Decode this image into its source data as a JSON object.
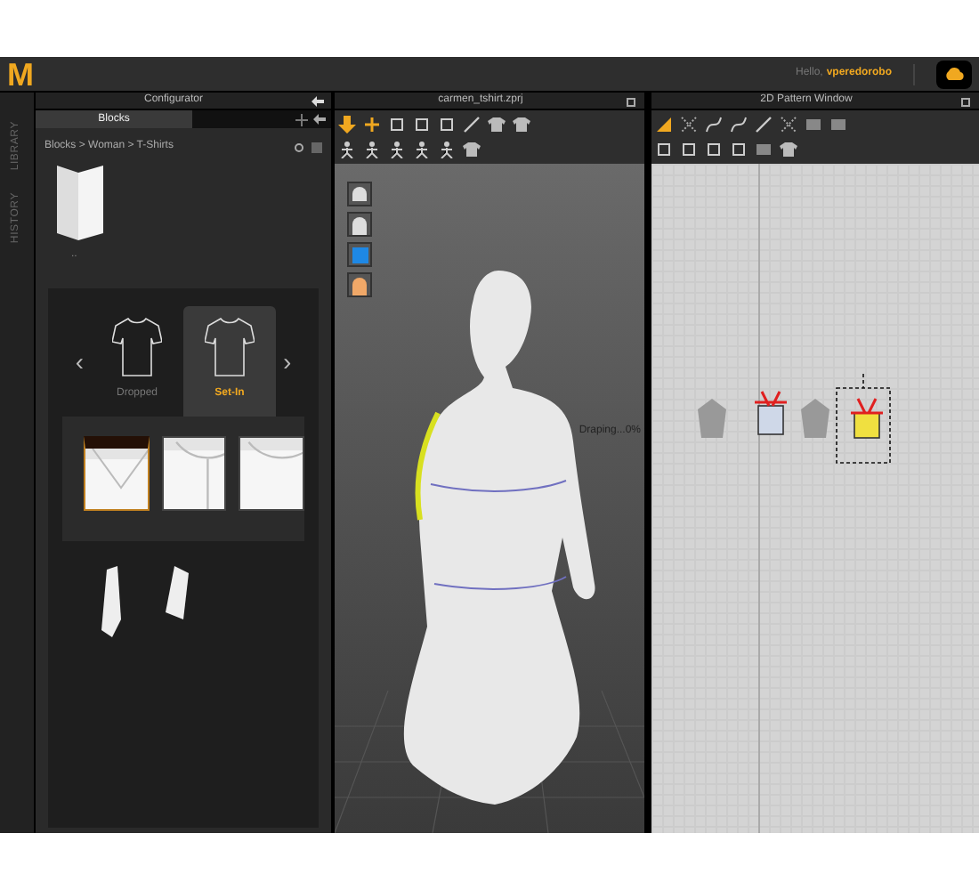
{
  "top_bar": {
    "logo": "M",
    "greeting": "Hello,",
    "user": "vperedorobo"
  },
  "side_tabs": [
    {
      "label": "LIBRARY"
    },
    {
      "label": "HISTORY"
    }
  ],
  "configurator": {
    "title": "Configurator",
    "tabs": [
      {
        "label": "Blocks",
        "selected": true
      }
    ],
    "breadcrumb": "Blocks > Woman > T-Shirts",
    "folder_label": "..",
    "carousel": {
      "previous": "‹",
      "next": "›"
    },
    "styles": [
      {
        "label": "Dropped",
        "selected": false
      },
      {
        "label": "Set-In",
        "selected": true
      }
    ],
    "necklines": [
      {
        "kind": "v-neck",
        "selected": true
      },
      {
        "kind": "henley",
        "selected": false
      },
      {
        "kind": "crew",
        "selected": false
      }
    ]
  },
  "viewport_3d": {
    "title": "carmen_tshirt.zprj",
    "status": "Draping...0%"
  },
  "pattern_window": {
    "title": "2D Pattern Window"
  }
}
